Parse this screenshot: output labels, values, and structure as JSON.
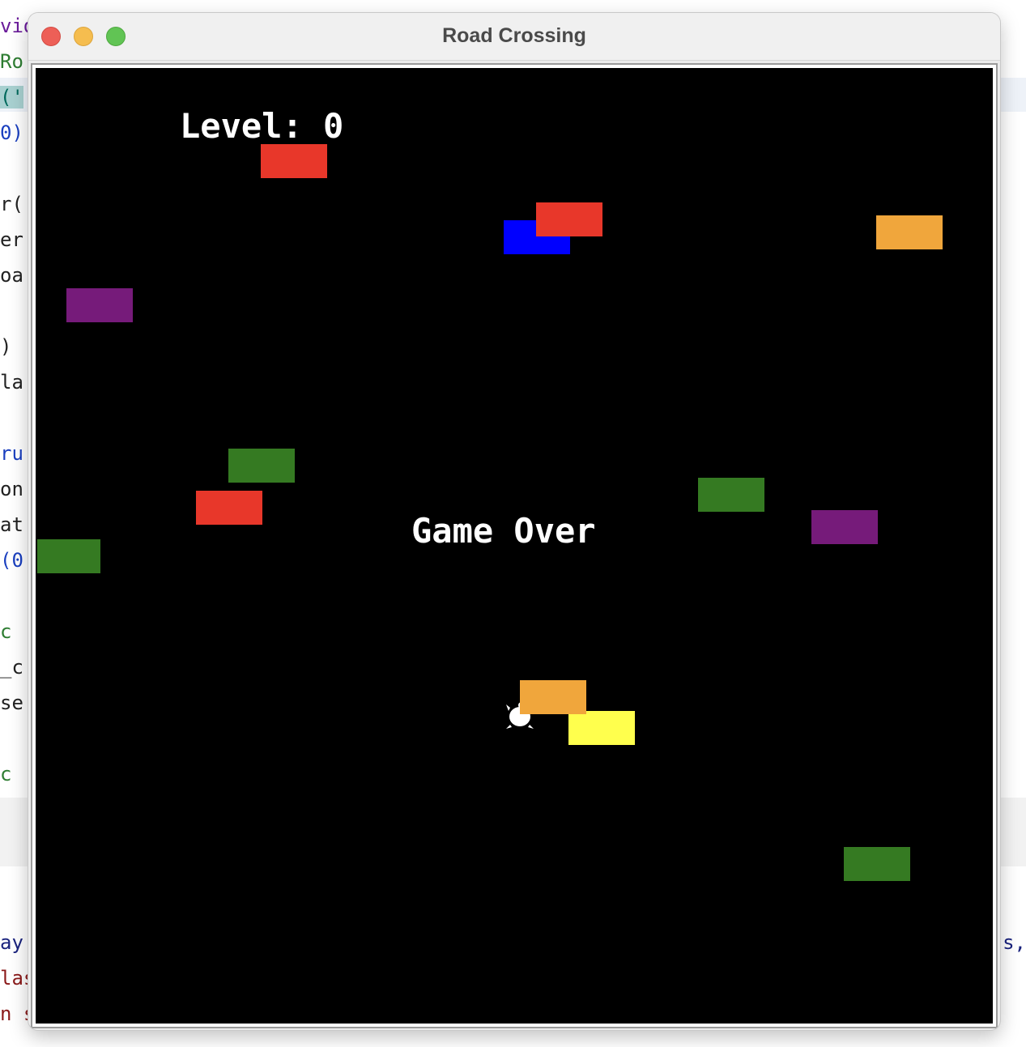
{
  "window": {
    "title": "Road Crossing"
  },
  "background_code": {
    "left_lines": [
      "vid",
      "Ro",
      "('",
      "0)",
      "",
      "r(",
      "er",
      "oa",
      "",
      ")",
      "la",
      "",
      "ru",
      "on",
      "at",
      "(0",
      "",
      "c",
      "_c",
      "se",
      "",
      "c"
    ],
    "bottom_left": [
      "ay",
      "las",
      "n s"
    ],
    "bottom_right": "ts,"
  },
  "game": {
    "scoreboard_text": "Level: 0",
    "gameover_text": "Game Over",
    "player": "turtle",
    "cars": [
      {
        "color": "#e8372a"
      },
      {
        "color": "#0000ff"
      },
      {
        "color": "#e8372a"
      },
      {
        "color": "#f0a63c"
      },
      {
        "color": "#761b7a"
      },
      {
        "color": "#357a22"
      },
      {
        "color": "#e8372a"
      },
      {
        "color": "#357a22"
      },
      {
        "color": "#357a22"
      },
      {
        "color": "#761b7a"
      },
      {
        "color": "#f0a63c"
      },
      {
        "color": "#ffff4d"
      },
      {
        "color": "#357a22"
      }
    ]
  }
}
